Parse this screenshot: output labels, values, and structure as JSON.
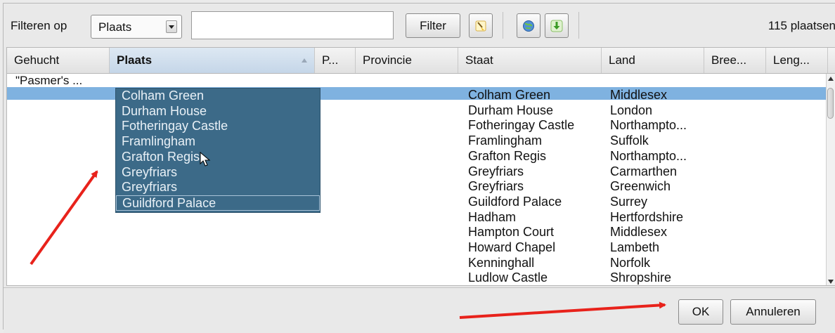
{
  "toolbar": {
    "filter_label": "Filteren op",
    "filter_field_value": "Plaats",
    "search_value": "",
    "filter_button": "Filter",
    "icons": [
      "broom-icon",
      "globe-icon",
      "download-icon"
    ],
    "count_text": "115 plaatsen"
  },
  "table": {
    "columns": [
      {
        "label": "Gehucht"
      },
      {
        "label": "Plaats",
        "sorted": "ascending"
      },
      {
        "label": "P..."
      },
      {
        "label": "Provincie"
      },
      {
        "label": "Staat"
      },
      {
        "label": "Land"
      },
      {
        "label": "Bree..."
      },
      {
        "label": "Leng..."
      }
    ],
    "first_row_gehucht": "\"Pasmer's ...",
    "staat_values": [
      "Colham Green",
      "Durham House",
      "Fotheringay Castle",
      "Framlingham",
      "Grafton Regis",
      "Greyfriars",
      "Greyfriars",
      "Guildford Palace",
      "Hadham",
      "Hampton Court",
      "Howard Chapel",
      "Kenninghall",
      "Ludlow Castle"
    ],
    "land_values": [
      "Middlesex",
      "London",
      "Northampto...",
      "Suffolk",
      "Northampto...",
      "Carmarthen",
      "Greenwich",
      "Surrey",
      "Hertfordshire",
      "Middlesex",
      "Lambeth",
      "Norfolk",
      "Shropshire"
    ],
    "plaats_dropdown": {
      "items": [
        "Colham Green",
        "Durham House",
        "Fotheringay Castle",
        "Framlingham",
        "Grafton Regis",
        "Greyfriars",
        "Greyfriars",
        "Guildford Palace"
      ],
      "active_index": 7
    }
  },
  "footer": {
    "ok_label": "OK",
    "cancel_label": "Annuleren"
  },
  "colors": {
    "selection": "#7fb2e0",
    "popup_background": "#3c6a88",
    "annotation_arrow": "#e8221b"
  }
}
